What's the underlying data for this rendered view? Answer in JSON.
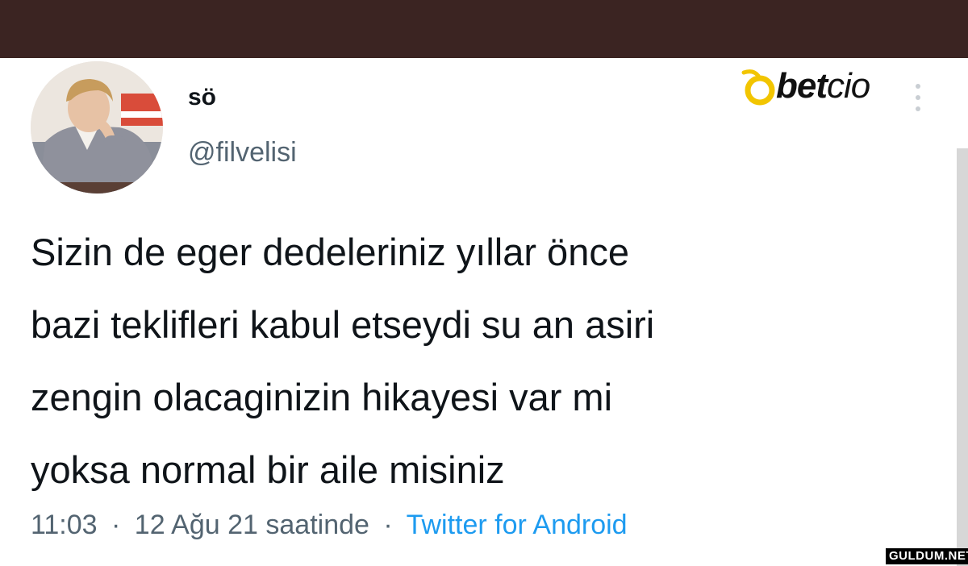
{
  "user": {
    "display_name": "sö",
    "handle": "@filvelisi"
  },
  "brand": {
    "name_bold": "bet",
    "name_light": "cio",
    "accent_color": "#f2c500"
  },
  "tweet": {
    "lines": [
      "Sizin de eger dedeleriniz yıllar önce",
      "bazi teklifleri kabul etseydi su an asiri",
      "zengin olacaginizin hikayesi var mi",
      "yoksa normal bir aile misiniz"
    ]
  },
  "meta": {
    "time": "11:03",
    "separator": "·",
    "date": "12 Ağu 21 saatinde",
    "source": "Twitter for Android"
  },
  "watermark": "GULDUM.NET",
  "icons": {
    "more": "more-vertical-icon"
  }
}
